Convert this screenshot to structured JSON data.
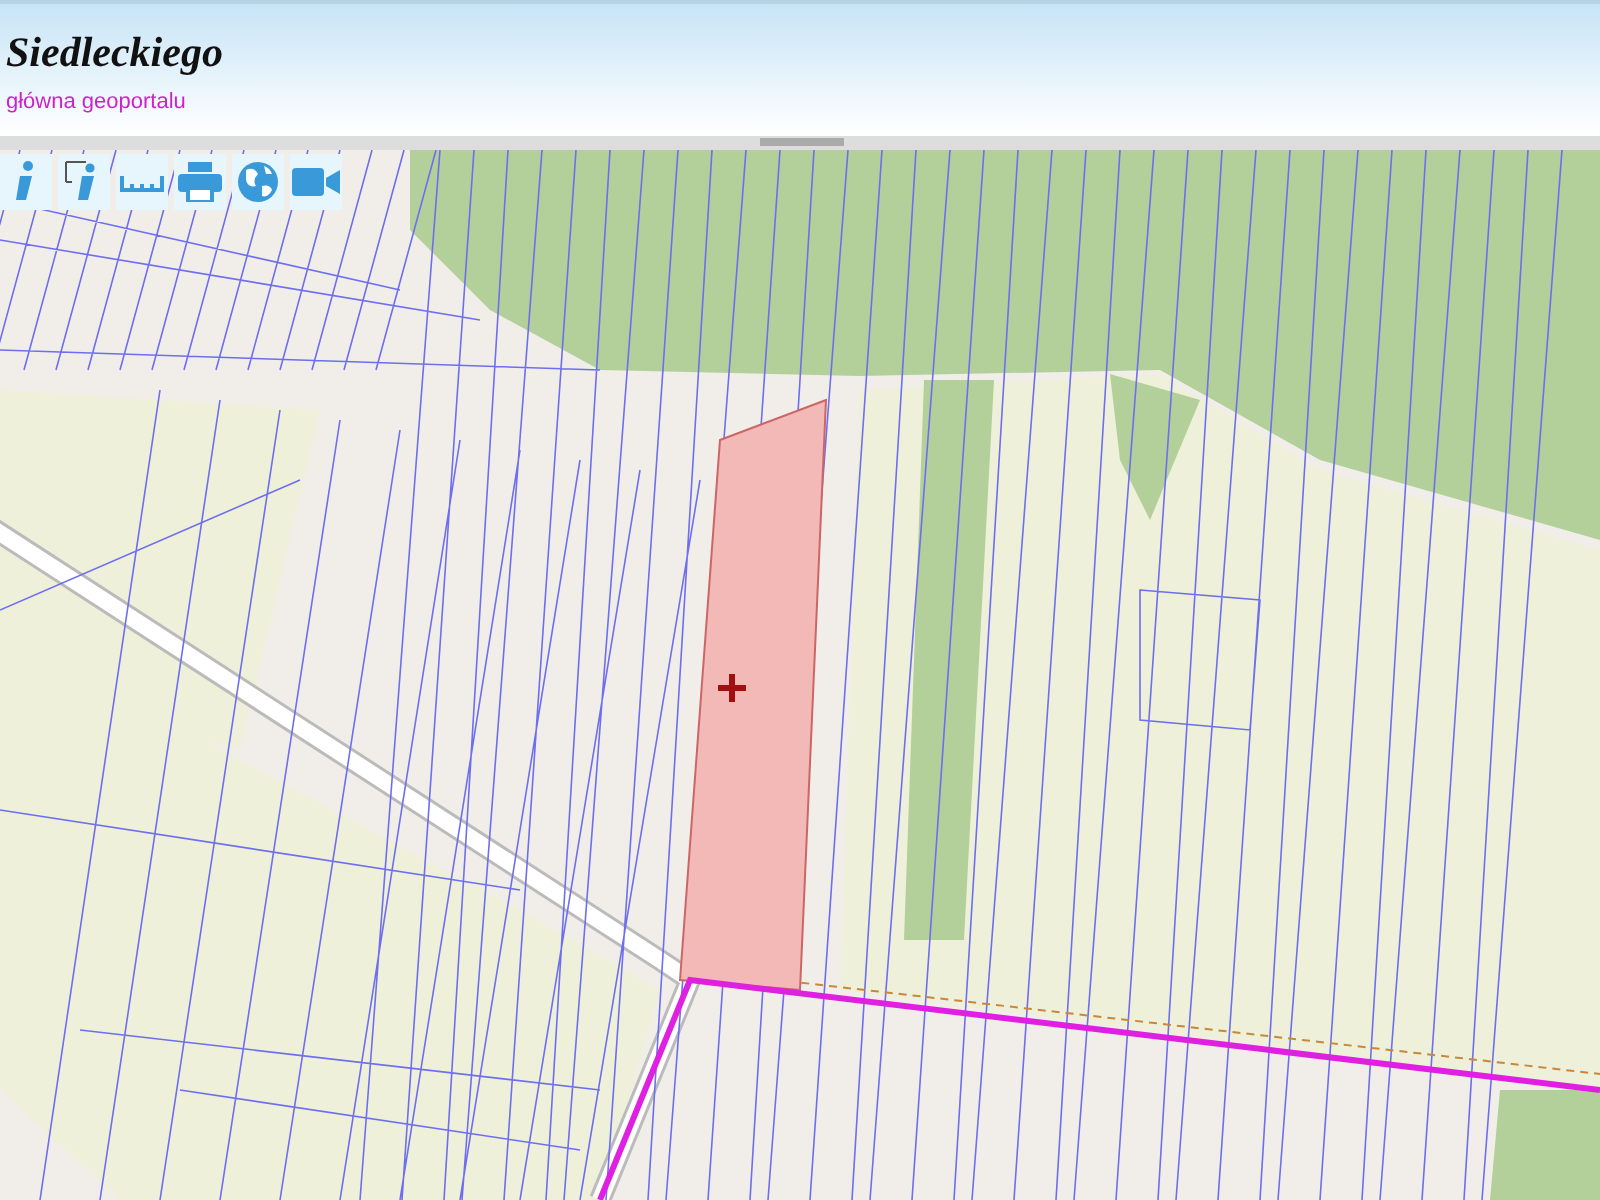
{
  "header": {
    "title": "Siedleckiego",
    "link": "główna geoportalu"
  },
  "toolbar": [
    {
      "kind": "info"
    },
    {
      "kind": "info-select"
    },
    {
      "kind": "measure"
    },
    {
      "kind": "print"
    },
    {
      "kind": "globe"
    },
    {
      "kind": "video"
    }
  ]
}
